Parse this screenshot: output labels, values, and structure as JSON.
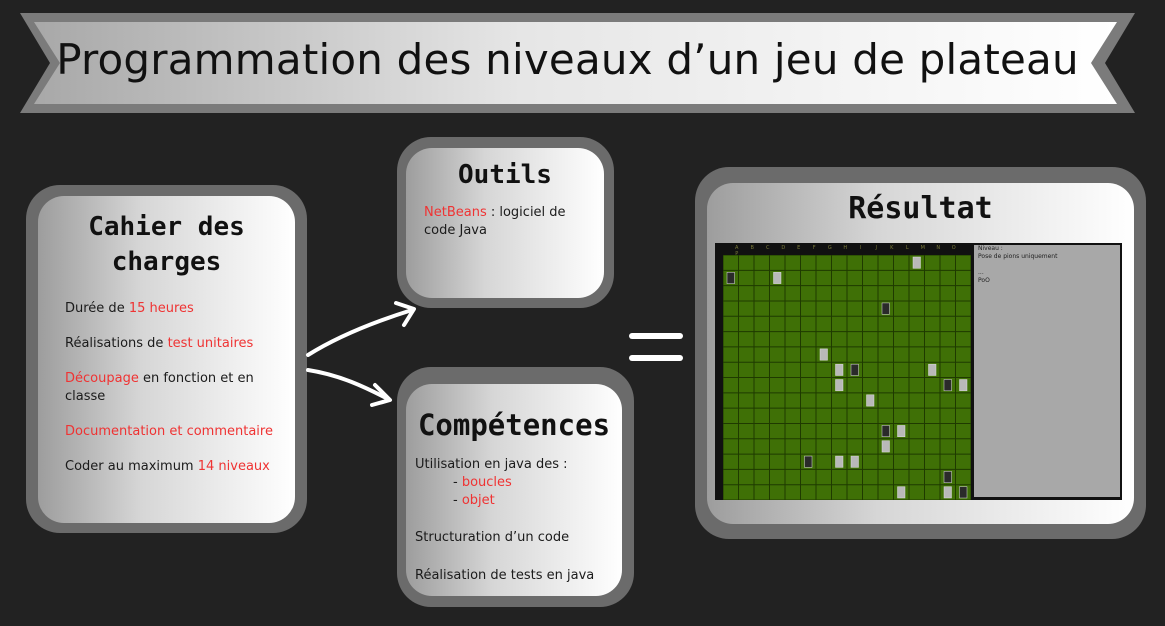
{
  "banner": {
    "title": "Programmation des niveaux d’un jeu de plateau"
  },
  "cahier": {
    "title": "Cahier des charges",
    "items": [
      {
        "pre": "Durée de ",
        "hl": "15 heures",
        "post": ""
      },
      {
        "pre": "Réalisations de ",
        "hl": "test unitaires",
        "post": ""
      },
      {
        "pre": "",
        "hl": "Découpage",
        "post": " en fonction et en classe"
      },
      {
        "pre": "",
        "hl": "Documentation et commentaire",
        "post": ""
      },
      {
        "pre": "Coder au maximum ",
        "hl": "14 niveaux",
        "post": ""
      }
    ]
  },
  "outils": {
    "title": "Outils",
    "hl": "NetBeans",
    "text": " : logiciel de code Java"
  },
  "competences": {
    "title": "Compétences",
    "intro": "Utilisation en java des :",
    "bullets": [
      "boucles",
      "objet"
    ],
    "bullet_prefix": "- ",
    "line2": "Structuration d’un code",
    "line3": "Réalisation de tests en java"
  },
  "resultat": {
    "title": "Résultat",
    "screenshot": {
      "letters": [
        "A",
        "B",
        "C",
        "D",
        "E",
        "F",
        "G",
        "H",
        "I",
        "J",
        "K",
        "L",
        "M",
        "N",
        "O",
        "P"
      ],
      "panel_lines": [
        "Niveau :",
        "Pose de pions uniquement",
        "",
        "...",
        "PoO"
      ]
    }
  },
  "colors": {
    "background": "#222222",
    "highlight": "#ef3333",
    "card_border": "#6b6b6b",
    "board_green": "#3f7006"
  }
}
